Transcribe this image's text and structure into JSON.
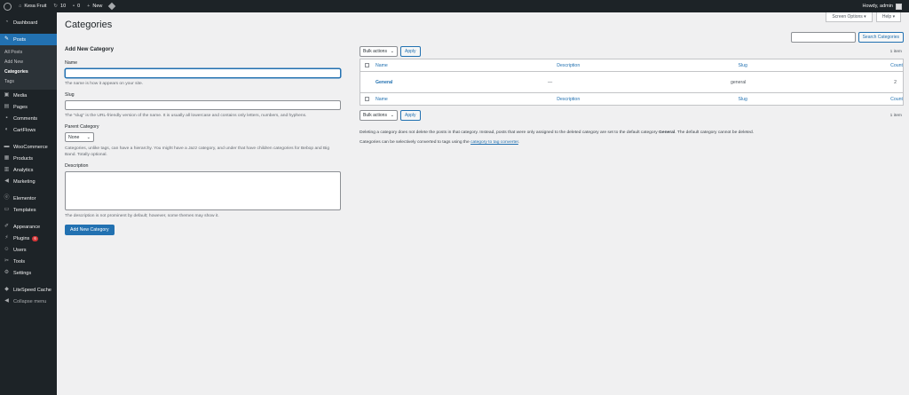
{
  "adminbar": {
    "site_name": "Kesa Fruit",
    "updates": "10",
    "comments": "0",
    "new_label": "New",
    "howdy": "Howdy, admin"
  },
  "sidebar": {
    "items": [
      {
        "label": "Dashboard",
        "icon": "dashboard-icon"
      },
      {
        "label": "Posts",
        "icon": "pin-icon"
      },
      {
        "label": "Media",
        "icon": "media-icon"
      },
      {
        "label": "Pages",
        "icon": "pages-icon"
      },
      {
        "label": "Comments",
        "icon": "comments-icon"
      },
      {
        "label": "CartFlows",
        "icon": "cartflows-icon"
      },
      {
        "label": "WooCommerce",
        "icon": "woocommerce-icon"
      },
      {
        "label": "Products",
        "icon": "products-icon"
      },
      {
        "label": "Analytics",
        "icon": "analytics-icon"
      },
      {
        "label": "Marketing",
        "icon": "marketing-icon"
      },
      {
        "label": "Elementor",
        "icon": "elementor-icon"
      },
      {
        "label": "Templates",
        "icon": "templates-icon"
      },
      {
        "label": "Appearance",
        "icon": "appearance-icon"
      },
      {
        "label": "Plugins",
        "icon": "plugins-icon",
        "badge": "6"
      },
      {
        "label": "Users",
        "icon": "users-icon"
      },
      {
        "label": "Tools",
        "icon": "tools-icon"
      },
      {
        "label": "Settings",
        "icon": "settings-icon"
      },
      {
        "label": "LiteSpeed Cache",
        "icon": "litespeed-icon"
      },
      {
        "label": "Collapse menu",
        "icon": "collapse-icon"
      }
    ],
    "posts_submenu": [
      "All Posts",
      "Add New",
      "Categories",
      "Tags"
    ]
  },
  "header": {
    "title": "Categories",
    "screen_options": "Screen Options",
    "help": "Help"
  },
  "form": {
    "heading": "Add New Category",
    "name_label": "Name",
    "name_desc": "The name is how it appears on your site.",
    "slug_label": "Slug",
    "slug_desc": "The “slug” is the URL-friendly version of the name. It is usually all lowercase and contains only letters, numbers, and hyphens.",
    "parent_label": "Parent Category",
    "parent_value": "None",
    "parent_desc": "Categories, unlike tags, can have a hierarchy. You might have a Jazz category, and under that have children categories for Bebop and Big Band. Totally optional.",
    "description_label": "Description",
    "description_desc": "The description is not prominent by default; however, some themes may show it.",
    "submit": "Add New Category"
  },
  "list": {
    "search_button": "Search Categories",
    "bulk_actions": "Bulk actions",
    "apply": "Apply",
    "items_count": "1 item",
    "columns": {
      "name": "Name",
      "description": "Description",
      "slug": "Slug",
      "count": "Count"
    },
    "rows": [
      {
        "name": "General",
        "description": "—",
        "slug": "general",
        "count": "2"
      }
    ],
    "note1_pre": "Deleting a category does not delete the posts in that category. Instead, posts that were only assigned to the deleted category are set to the default category",
    "note1_bold": "General",
    "note1_post": ". The default category cannot be deleted.",
    "note2_pre": "Categories can be selectively converted to tags using the",
    "note2_link": "category to tag converter",
    "note2_post": "."
  }
}
